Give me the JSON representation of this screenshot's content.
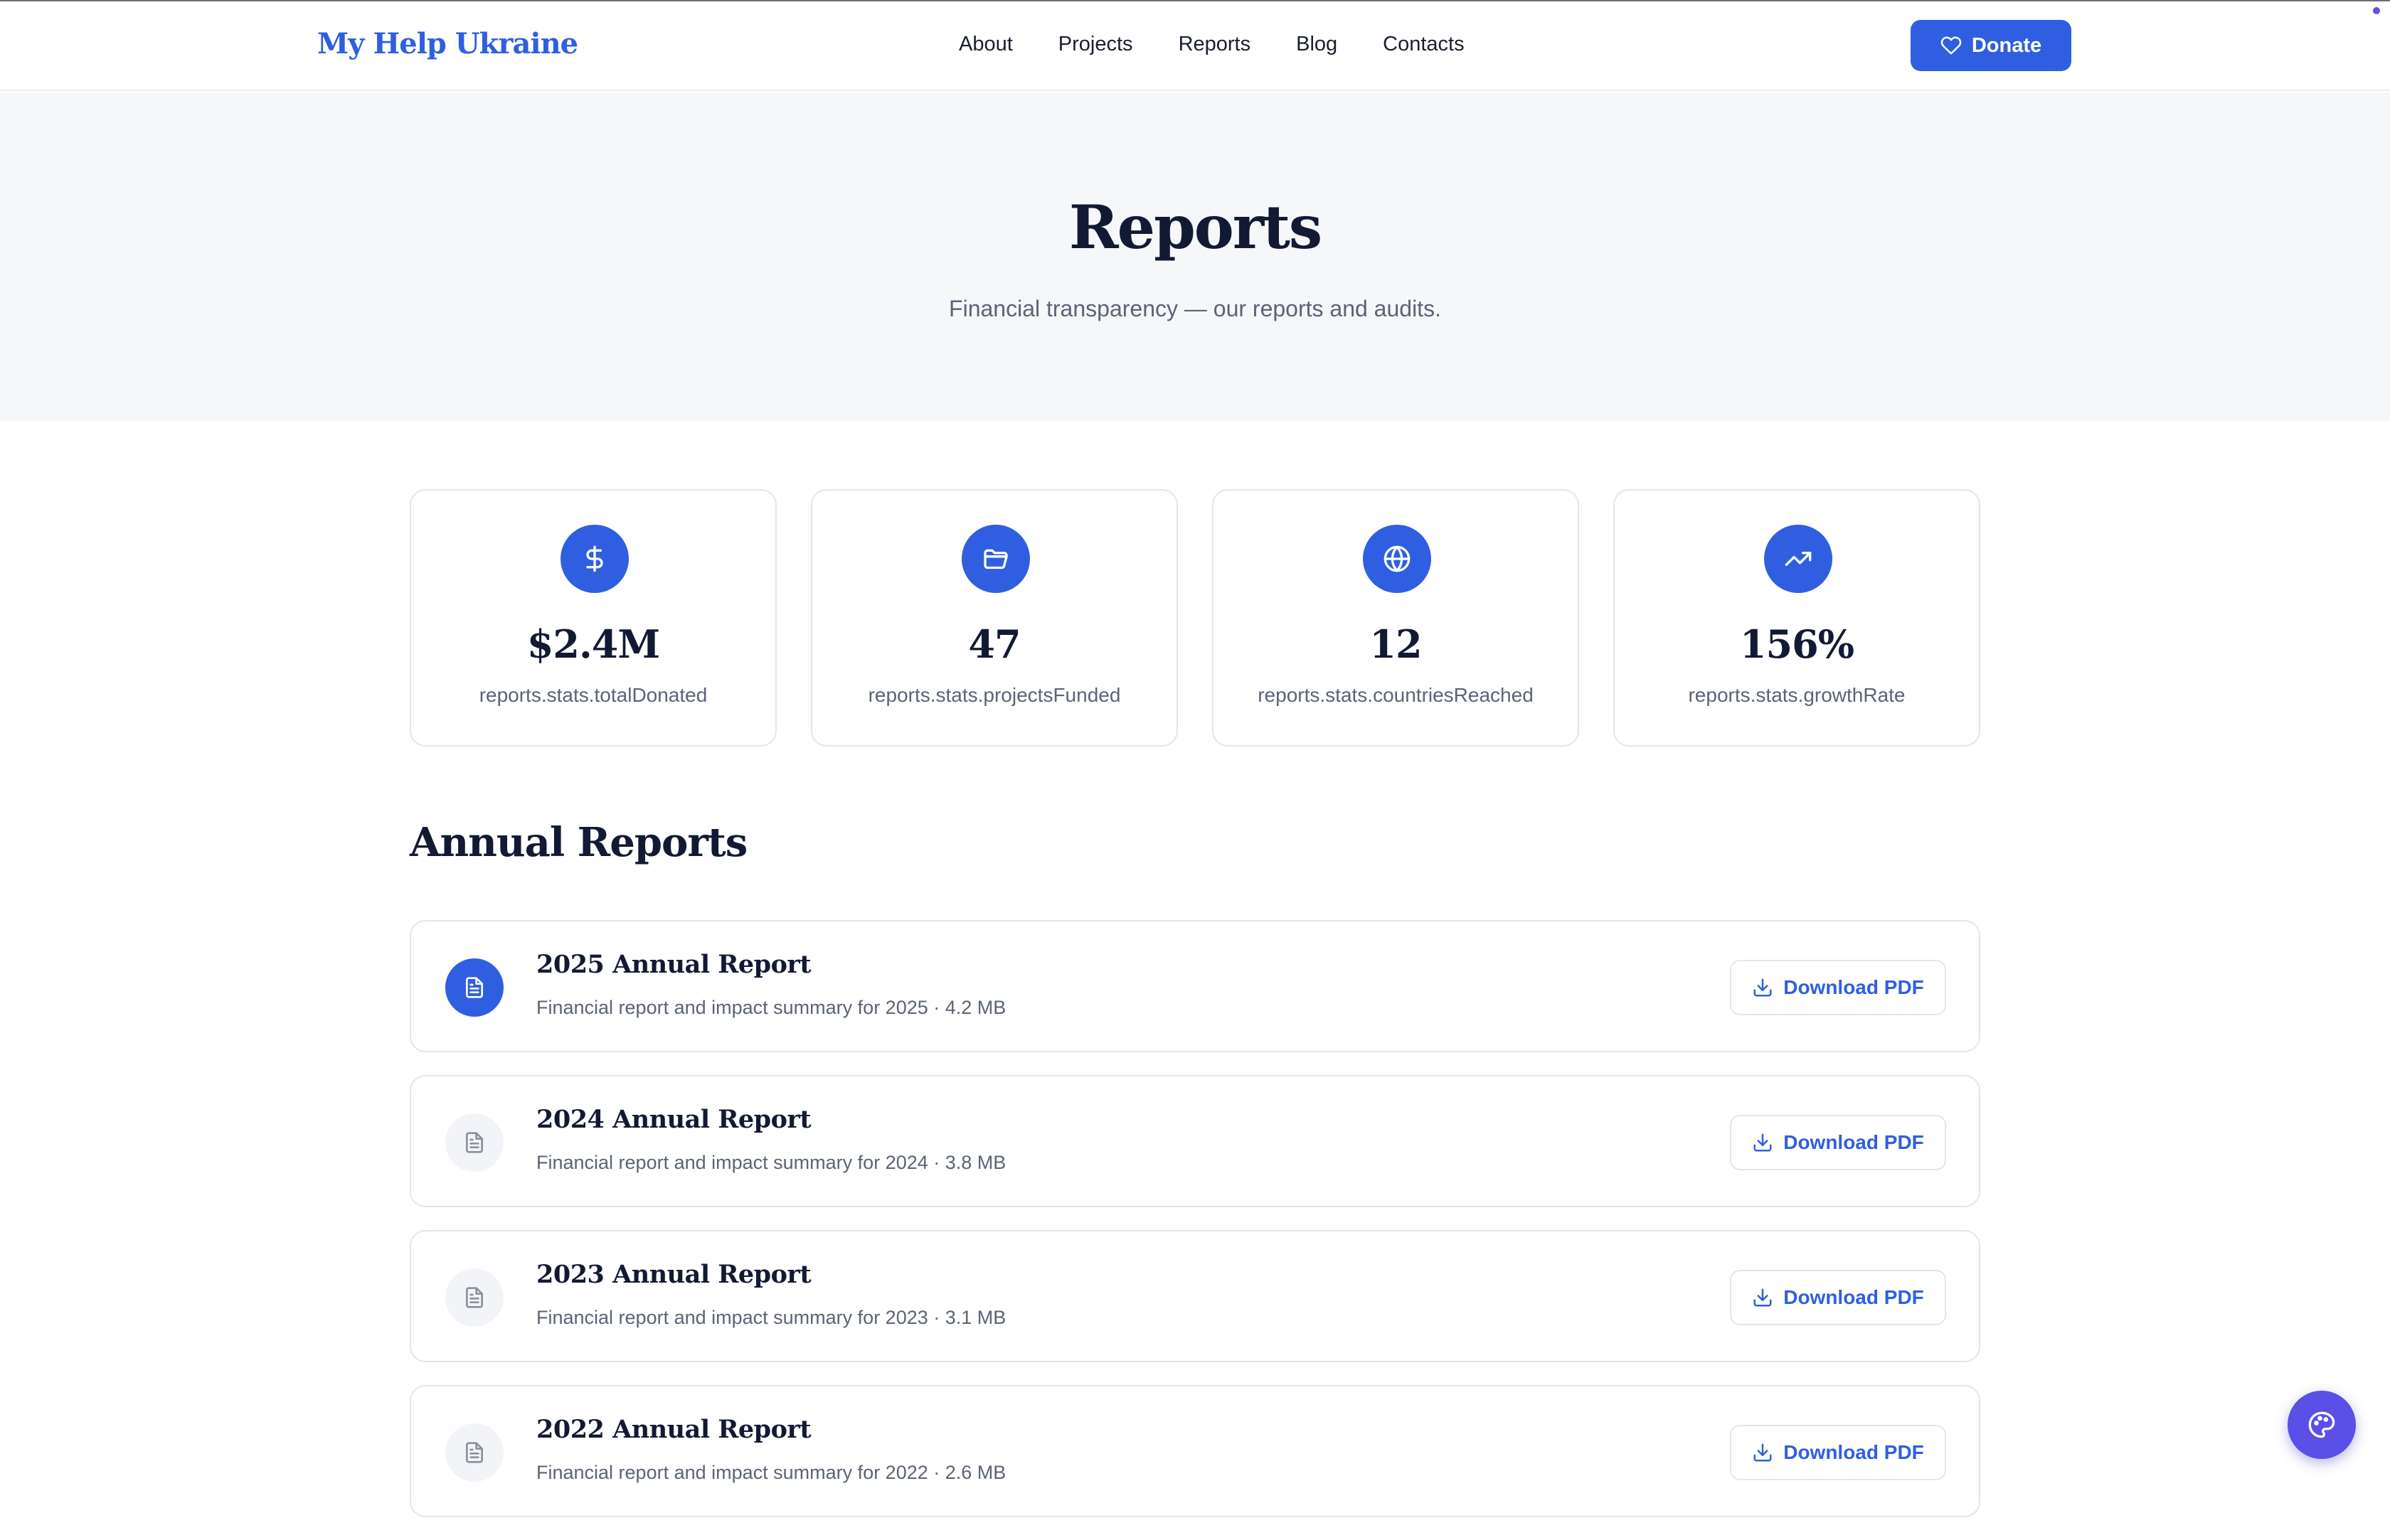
{
  "header": {
    "logo": "My Help Ukraine",
    "nav": [
      "About",
      "Projects",
      "Reports",
      "Blog",
      "Contacts"
    ],
    "donate_label": "Donate"
  },
  "hero": {
    "title": "Reports",
    "subtitle": "Financial transparency — our reports and audits."
  },
  "stats": [
    {
      "icon": "dollar-icon",
      "value": "$2.4M",
      "label": "reports.stats.totalDonated"
    },
    {
      "icon": "folder-icon",
      "value": "47",
      "label": "reports.stats.projectsFunded"
    },
    {
      "icon": "globe-icon",
      "value": "12",
      "label": "reports.stats.countriesReached"
    },
    {
      "icon": "trending-up-icon",
      "value": "156%",
      "label": "reports.stats.growthRate"
    }
  ],
  "annual": {
    "title": "Annual Reports",
    "items": [
      {
        "title": "2025 Annual Report",
        "desc": "Financial report and impact summary for 2025 · 4.2 MB",
        "button": "Download PDF",
        "highlighted": true
      },
      {
        "title": "2024 Annual Report",
        "desc": "Financial report and impact summary for 2024 · 3.8 MB",
        "button": "Download PDF",
        "highlighted": false
      },
      {
        "title": "2023 Annual Report",
        "desc": "Financial report and impact summary for 2023 · 3.1 MB",
        "button": "Download PDF",
        "highlighted": false
      },
      {
        "title": "2022 Annual Report",
        "desc": "Financial report and impact summary for 2022 · 2.6 MB",
        "button": "Download PDF",
        "highlighted": false
      }
    ]
  },
  "colors": {
    "accent": "#2f5fe0",
    "fab": "#5a4fe6",
    "hero_bg": "#f6f7f9"
  },
  "fab_icon": "palette-icon"
}
